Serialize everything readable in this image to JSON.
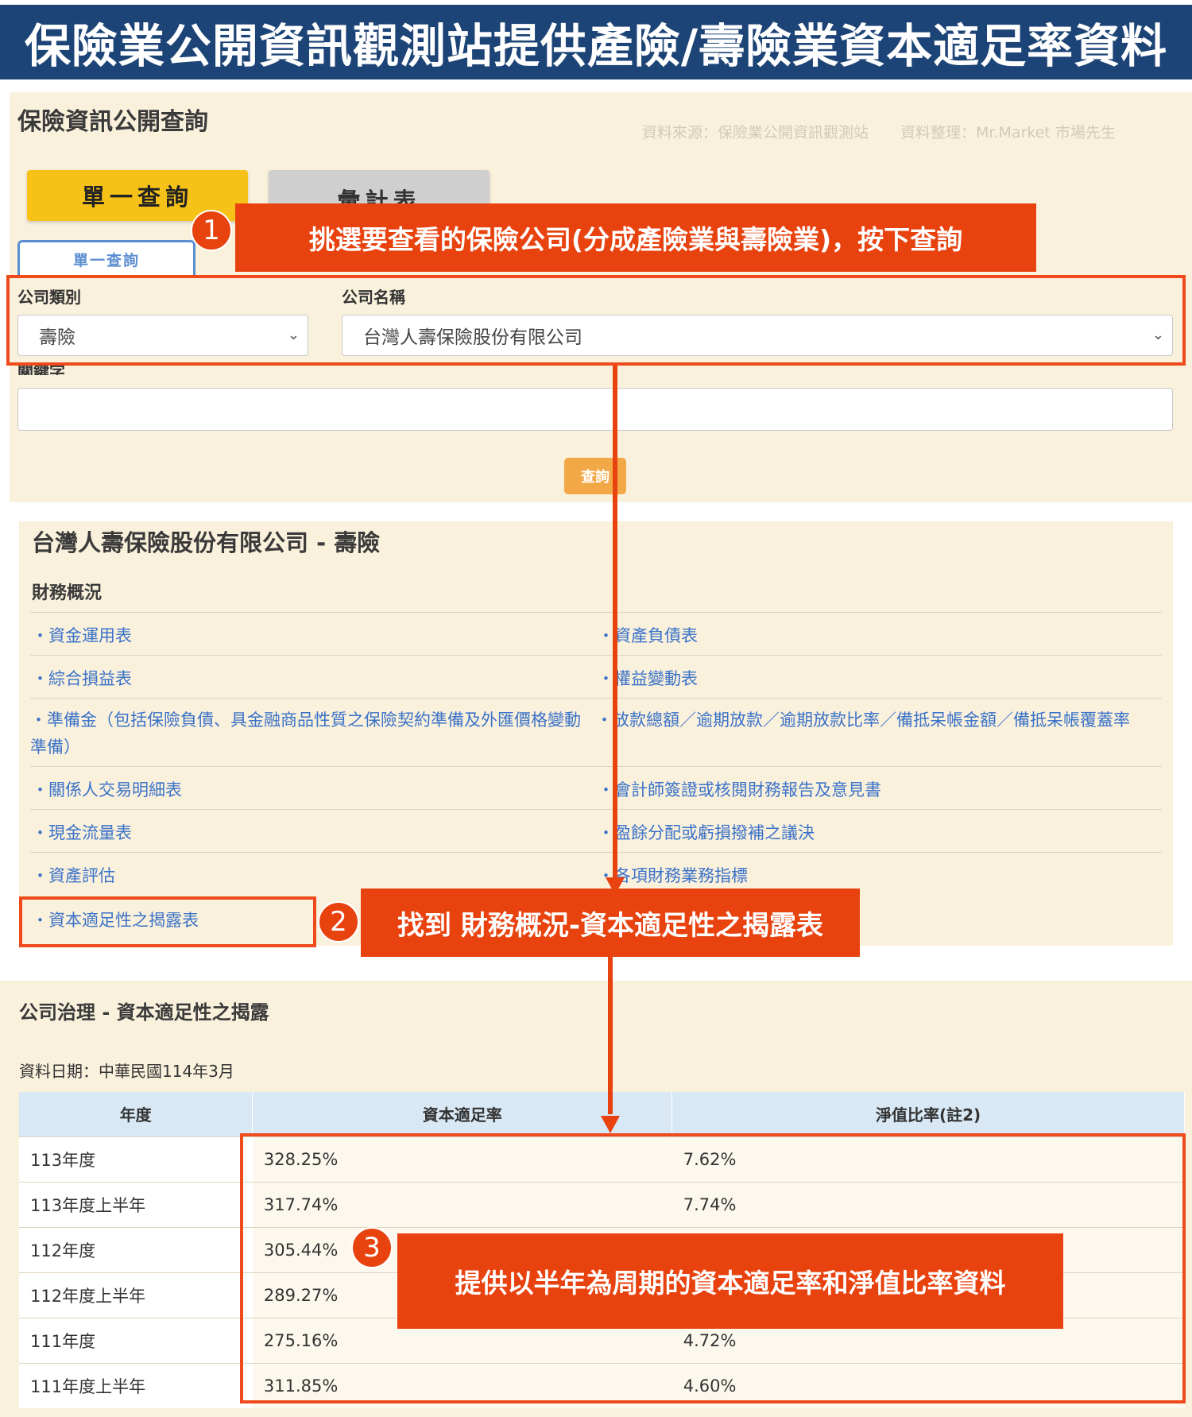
{
  "banner": {
    "title": "保險業公開資訊觀測站提供產險/壽險業資本適足率資料"
  },
  "query": {
    "title": "保險資訊公開查詢",
    "source_note": {
      "source": "資料來源：保險業公開資訊觀測站",
      "compiler": "資料整理：Mr.Market 市場先生"
    },
    "tabs": [
      {
        "label": "單一查詢",
        "active": true
      },
      {
        "label": "彙計表",
        "active": false
      }
    ],
    "subtab": "單一查詢",
    "company_type": {
      "label": "公司類別",
      "value": "壽險"
    },
    "company_name": {
      "label": "公司名稱",
      "value": "台灣人壽保險股份有限公司"
    },
    "keyword": {
      "label": "關鍵字",
      "value": ""
    },
    "button": "查詢"
  },
  "company": {
    "title": "台灣人壽保險股份有限公司 - 壽險",
    "section": "財務概況",
    "left_links": [
      "・資金運用表",
      "・綜合損益表",
      "・準備金（包括保險負債、具金融商品性質之保險契約準備及外匯價格變動準備）",
      "・關係人交易明細表",
      "・現金流量表",
      "・資產評估",
      "・資本適足性之揭露表"
    ],
    "right_links": [
      "・資產負債表",
      "・權益變動表",
      "・放款總額／逾期放款／逾期放款比率／備抵呆帳金額／備抵呆帳覆蓋率",
      "・會計師簽證或核閱財務報告及意見書",
      "・盈餘分配或虧損撥補之議決",
      "・各項財務業務指標"
    ]
  },
  "disclosure": {
    "title": "公司治理 - 資本適足性之揭露",
    "date": "資料日期：中華民國114年3月",
    "columns": [
      "年度",
      "資本適足率",
      "淨值比率(註2)"
    ],
    "rows": [
      [
        "113年度",
        "328.25%",
        "7.62%"
      ],
      [
        "113年度上半年",
        "317.74%",
        "7.74%"
      ],
      [
        "112年度",
        "305.44%",
        ""
      ],
      [
        "112年度上半年",
        "289.27%",
        ""
      ],
      [
        "111年度",
        "275.16%",
        "4.72%"
      ],
      [
        "111年度上半年",
        "311.85%",
        "4.60%"
      ]
    ]
  },
  "annotations": {
    "step1": {
      "number": "1",
      "text": "挑選要查看的保險公司(分成產險業與壽險業)，按下查詢"
    },
    "step2": {
      "number": "2",
      "text": "找到 財務概況-資本適足性之揭露表"
    },
    "step3": {
      "number": "3",
      "text": "提供以半年為周期的資本適足率和淨值比率資料"
    }
  },
  "colors": {
    "banner": "#1d4476",
    "panel": "#faf1dd",
    "accent_tab": "#f6c218",
    "query_button": "#f3a847",
    "link": "#3b72c8",
    "annotation": "#e8420e",
    "table_header": "#d8e8f4"
  }
}
